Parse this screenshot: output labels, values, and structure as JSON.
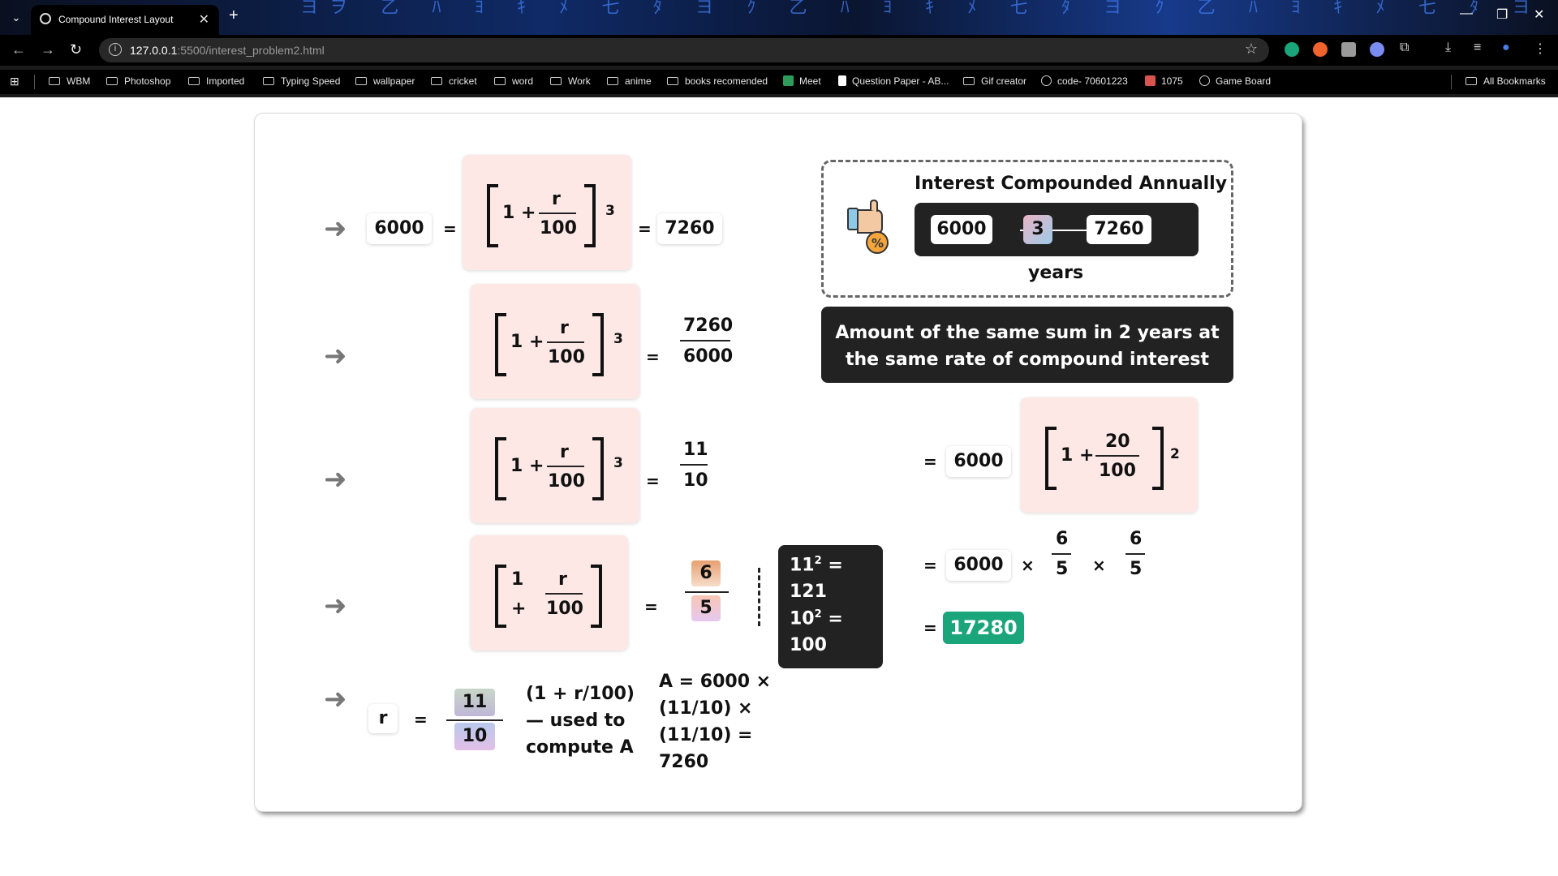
{
  "browser": {
    "tab_title": "Compound Interest Layout",
    "url_host": "127.0.0.1",
    "url_path": ":5500/interest_problem2.html",
    "bookmarks": [
      "WBM",
      "Photoshop",
      "Imported",
      "Typing Speed",
      "wallpaper",
      "cricket",
      "word",
      "Work",
      "anime",
      "books recomended",
      "Meet",
      "Question Paper - AB...",
      "Gif creator",
      "code- 70601223",
      "1075",
      "Game Board"
    ],
    "all_bookmarks": "All Bookmarks"
  },
  "steps": {
    "row1": {
      "principal": "6000",
      "one_plus": "1 +",
      "r": "r",
      "hundred": "100",
      "exp": "3",
      "amount": "7260",
      "eq": "="
    },
    "row2": {
      "one_plus": "1 +",
      "r": "r",
      "hundred": "100",
      "exp": "3",
      "num": "7260",
      "den": "6000",
      "eq": "="
    },
    "row3": {
      "one_plus": "1 +",
      "r": "r",
      "hundred": "100",
      "exp": "3",
      "num": "11",
      "den": "10",
      "eq": "="
    },
    "row4": {
      "one": "1",
      "plus": "+",
      "r": "r",
      "hundred": "100",
      "num": "6",
      "den": "5",
      "eq": "="
    },
    "row5": {
      "r": "r",
      "eq": "=",
      "num": "11",
      "den": "10",
      "note_lines": [
        "(1 + r/100)",
        "— used to",
        "compute A"
      ],
      "formula_lines": [
        "A = 6000 ×",
        "(11/10) ×",
        "(11/10) =",
        "7260"
      ]
    }
  },
  "squares": {
    "l1_base": "11",
    "l1_rest": " =",
    "l2": "121",
    "l3_base": "10",
    "l3_rest": " =",
    "l4": "100",
    "sup": "2"
  },
  "summary": {
    "title": "Interest Compounded Annually",
    "principal": "6000",
    "years_value": "3",
    "amount": "7260",
    "years_label": "years",
    "question_line1": "Amount of the same sum in 2 years at",
    "question_line2": "the same rate of compound interest"
  },
  "solution": {
    "eq": "=",
    "principal": "6000",
    "one_plus": "1 +",
    "rate": "20",
    "hundred": "100",
    "exp": "2",
    "times": "×",
    "f1_num": "6",
    "f1_den": "5",
    "f2_num": "6",
    "f2_den": "5",
    "result": "17280"
  },
  "colors": {
    "pink_bg": "#fde8e6",
    "dark_panel": "#222222",
    "result_green": "#1aa57a"
  }
}
